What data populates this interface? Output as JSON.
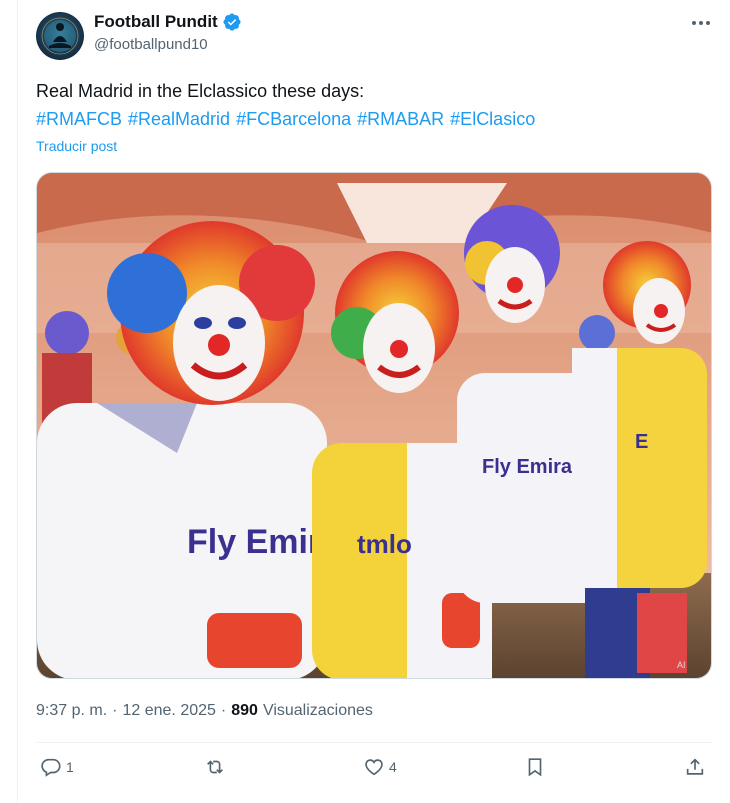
{
  "author": {
    "display_name": "Football Pundit",
    "handle": "@footballpund10",
    "verified": true
  },
  "tweet": {
    "text": "Real Madrid in the Elclassico these days:",
    "hashtags": [
      "#RMAFCB",
      "#RealMadrid",
      "#FCBarcelona",
      "#RMABAR",
      "#ElClasico"
    ],
    "translate_label": "Traducir post"
  },
  "media": {
    "description_icon": "photo-icon",
    "shirt_texts": [
      "Fly Emirat",
      "tmlo",
      "Fly Emira",
      "E"
    ],
    "watermark": "AI"
  },
  "meta": {
    "time": "9:37 p. m.",
    "separator": "·",
    "date": "12 ene. 2025",
    "separator2": "·",
    "views_count": "890",
    "views_label": "Visualizaciones"
  },
  "actions": {
    "reply_count": "1",
    "repost_count": "",
    "like_count": "4",
    "bookmark_count": "",
    "share_count": ""
  },
  "colors": {
    "accent": "#1d9bf0",
    "text": "#0f1419",
    "secondary": "#536471"
  }
}
